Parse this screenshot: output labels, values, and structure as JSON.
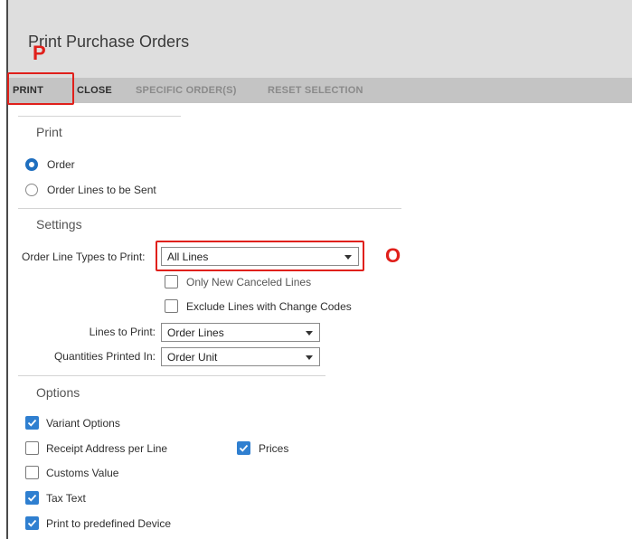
{
  "window": {
    "title": "Print Purchase Orders"
  },
  "toolbar": {
    "print_label": "PRINT",
    "close_label": "CLOSE",
    "specific_orders_label": "SPECIFIC ORDER(S)",
    "reset_selection_label": "RESET SELECTION"
  },
  "annotations": {
    "print_marker": "P",
    "line_types_marker": "O",
    "color": "#e0201b"
  },
  "print_section": {
    "title": "Print",
    "options": [
      {
        "label": "Order",
        "selected": true
      },
      {
        "label": "Order Lines to be Sent",
        "selected": false
      }
    ]
  },
  "settings": {
    "title": "Settings",
    "order_line_types_label": "Order Line Types to Print:",
    "order_line_types_value": "All Lines",
    "only_new_canceled_label": "Only New Canceled Lines",
    "exclude_change_codes_label": "Exclude Lines with Change Codes",
    "lines_to_print_label": "Lines to Print:",
    "lines_to_print_value": "Order Lines",
    "quantities_label": "Quantities Printed In:",
    "quantities_value": "Order Unit"
  },
  "options": {
    "title": "Options",
    "variant_options": {
      "label": "Variant Options",
      "checked": true
    },
    "receipt_address": {
      "label": "Receipt Address per Line",
      "checked": false
    },
    "prices": {
      "label": "Prices",
      "checked": true
    },
    "customs_value": {
      "label": "Customs Value",
      "checked": false
    },
    "tax_text": {
      "label": "Tax Text",
      "checked": true
    },
    "predefined_device": {
      "label": "Print to predefined Device",
      "checked": true
    }
  },
  "colors": {
    "accent": "#2f7fd0",
    "titlebar": "#dedede",
    "toolbar": "#c4c4c4"
  }
}
